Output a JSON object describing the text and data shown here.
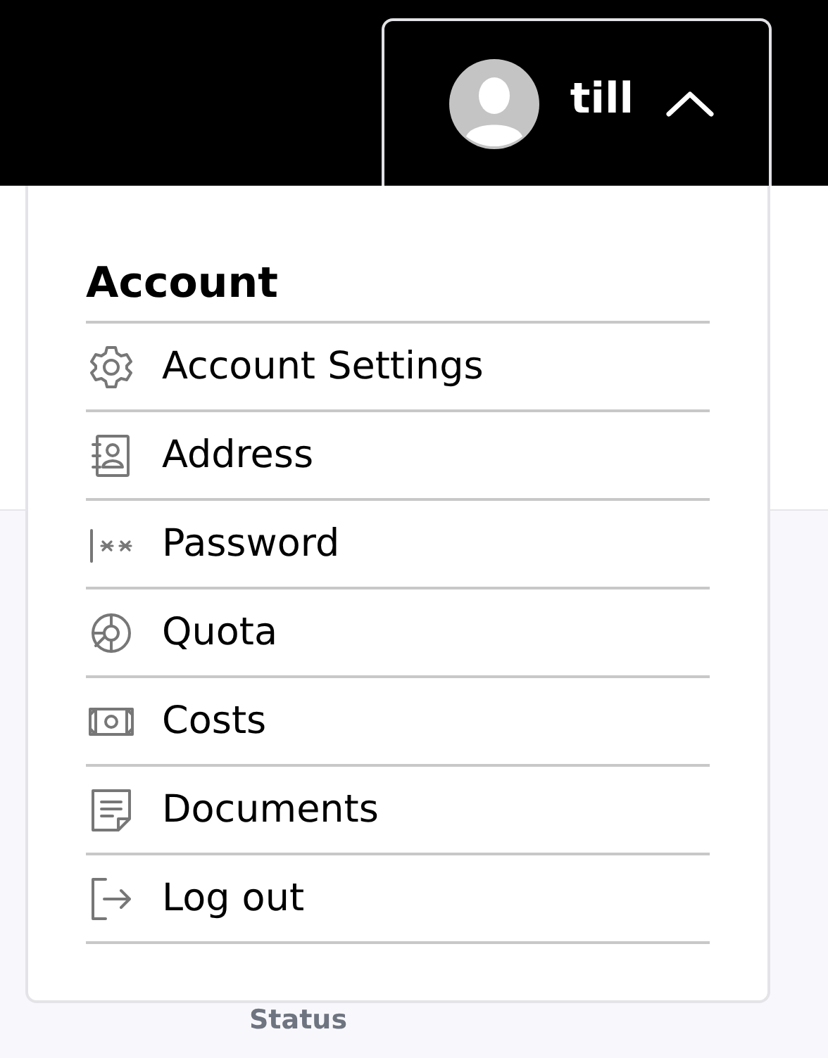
{
  "user_button": {
    "name": "till",
    "expanded": true
  },
  "menu": {
    "heading": "Account",
    "items": [
      {
        "label": "Account Settings"
      },
      {
        "label": "Address"
      },
      {
        "label": "Password"
      },
      {
        "label": "Quota"
      },
      {
        "label": "Costs"
      },
      {
        "label": "Documents"
      },
      {
        "label": "Log out"
      }
    ]
  },
  "background": {
    "column_label": "Status"
  }
}
